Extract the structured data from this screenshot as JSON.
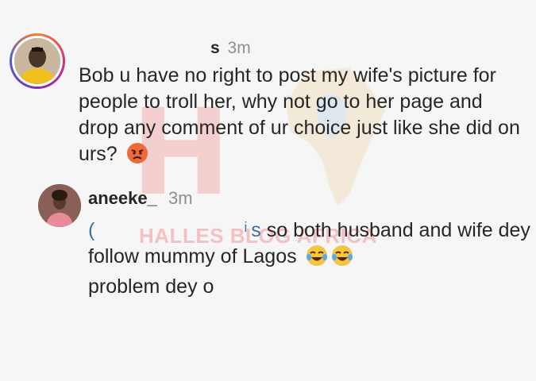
{
  "watermark": {
    "letter": "H",
    "text": "HALLES BLOG AFRICA"
  },
  "comments": [
    {
      "username": "s",
      "time": "3m",
      "text": "Bob u have no right to post my wife's picture for people to troll her, why not go to her page and drop any comment of ur choice just like she did on urs?",
      "emoji": "angry-face"
    },
    {
      "username": "aneeke_",
      "time": "3m",
      "mention_start": "(",
      "mention_end": "ͥ s",
      "text": " so both husband and wife dey follow mummy of Lagos",
      "text2": "problem dey o",
      "emoji": "tears-of-joy x2"
    }
  ]
}
